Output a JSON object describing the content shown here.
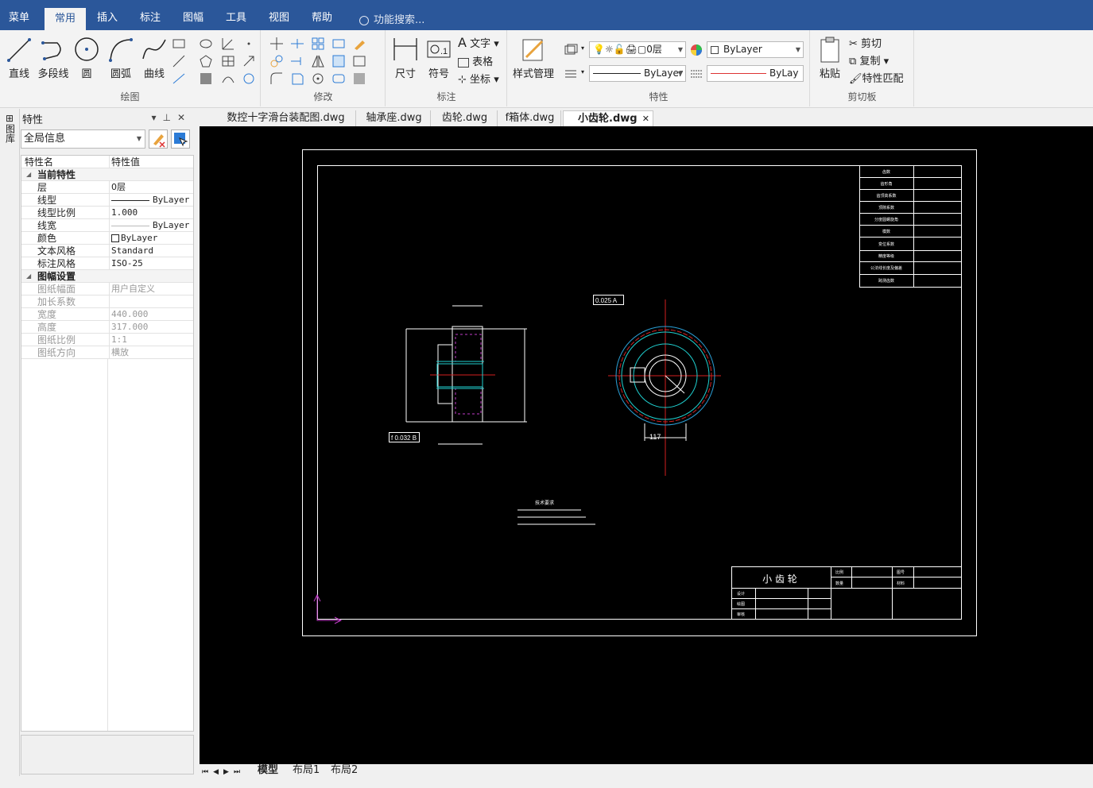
{
  "menu": {
    "tabs": [
      "菜单",
      "常用",
      "插入",
      "标注",
      "图幅",
      "工具",
      "视图",
      "帮助"
    ],
    "active": "常用",
    "search": "功能搜索..."
  },
  "ribbon": {
    "draw": {
      "label": "绘图",
      "line": "直线",
      "polyline": "多段线",
      "circle": "圆",
      "arc": "圆弧",
      "curve": "曲线"
    },
    "modify": {
      "label": "修改"
    },
    "annot": {
      "label": "标注",
      "dim": "尺寸",
      "symbol": "符号",
      "text": "文字",
      "table": "表格",
      "coord": "坐标"
    },
    "props": {
      "label": "特性",
      "style": "样式管理",
      "layer": "0层",
      "color": "ByLayer",
      "linetype": "ByLayer",
      "lineweight": "ByLay"
    },
    "clip": {
      "label": "剪切板",
      "paste": "粘贴",
      "cut": "剪切",
      "copy": "复制",
      "match": "特性匹配"
    }
  },
  "leftstrip": {
    "label": "图库"
  },
  "panel": {
    "title": "特性",
    "selector": "全局信息",
    "header": {
      "name": "特性名",
      "value": "特性值"
    },
    "section1": "当前特性",
    "rows1": [
      {
        "n": "层",
        "v": "0层"
      },
      {
        "n": "线型",
        "v": "ByLayer"
      },
      {
        "n": "线型比例",
        "v": "1.000"
      },
      {
        "n": "线宽",
        "v": "ByLayer"
      },
      {
        "n": "颜色",
        "v": "ByLayer"
      },
      {
        "n": "文本风格",
        "v": "Standard"
      },
      {
        "n": "标注风格",
        "v": "ISO-25"
      }
    ],
    "section2": "图幅设置",
    "rows2": [
      {
        "n": "图纸幅面",
        "v": "用户自定义"
      },
      {
        "n": "加长系数",
        "v": ""
      },
      {
        "n": "宽度",
        "v": "440.000"
      },
      {
        "n": "高度",
        "v": "317.000"
      },
      {
        "n": "图纸比例",
        "v": "1:1"
      },
      {
        "n": "图纸方向",
        "v": "横放"
      }
    ]
  },
  "doctabs": [
    "数控十字滑台装配图.dwg",
    "轴承座.dwg",
    "齿轮.dwg",
    "f箱体.dwg",
    "小齿轮.dwg"
  ],
  "activeDoc": "小齿轮.dwg",
  "drawing": {
    "title": "小  齿  轮",
    "tol_left": "f 0.032 B",
    "tol_right": "0.025 A",
    "dim117": "117",
    "notes_title": "技术要求",
    "title_cells": {
      "ratio": "比例",
      "no": "图号",
      "qty": "数量",
      "mat": "材料",
      "design": "设计",
      "draw": "绘图",
      "review": "审核"
    },
    "table_rows": [
      "齿数",
      "齿形角",
      "齿顶高系数",
      "顶隙系数",
      "分度圆螺旋角",
      "模数",
      "变位系数",
      "精度等级",
      "公法线长度及偏差",
      "跨测齿数"
    ]
  },
  "layouts": {
    "model": "模型",
    "l1": "布局1",
    "l2": "布局2"
  },
  "colors": {
    "accent": "#2b579a",
    "drawBg": "#000000"
  }
}
